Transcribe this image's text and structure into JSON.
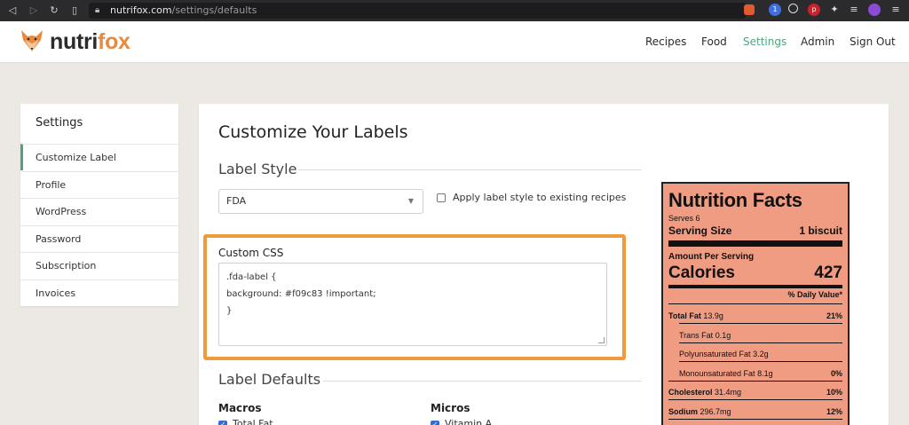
{
  "browser": {
    "url_host": "nutrifox.com",
    "url_path": "/settings/defaults"
  },
  "header": {
    "logo_part1": "nutri",
    "logo_part2": "fox",
    "nav": [
      "Recipes",
      "Food",
      "Settings",
      "Admin",
      "Sign Out"
    ],
    "active_nav": "Settings",
    "accent_color": "#4fa47f"
  },
  "sidebar": {
    "title": "Settings",
    "items": [
      {
        "label": "Customize Label"
      },
      {
        "label": "Profile"
      },
      {
        "label": "WordPress"
      },
      {
        "label": "Password"
      },
      {
        "label": "Subscription"
      },
      {
        "label": "Invoices"
      }
    ],
    "active_item": "Customize Label"
  },
  "main": {
    "title": "Customize Your Labels",
    "label_style_section": "Label Style",
    "style_select_value": "FDA",
    "apply_checkbox_label": "Apply label style to existing recipes",
    "custom_css_label": "Custom CSS",
    "custom_css_lines": [
      ".fda-label {",
      "background: #f09c83 !important;",
      "}"
    ],
    "highlight_color": "#ef9a3b",
    "label_defaults_section": "Label Defaults",
    "macros_heading": "Macros",
    "micros_heading": "Micros",
    "macros_first_item": "Total Fat",
    "micros_first_item": "Vitamin A"
  },
  "nutrition_label": {
    "background": "#f09c83",
    "title": "Nutrition Facts",
    "serves": "Serves 6",
    "serving_size_label": "Serving Size",
    "serving_size_value": "1 biscuit",
    "amount_per_serving": "Amount Per Serving",
    "calories_label": "Calories",
    "calories_value": "427",
    "daily_value_header": "% Daily Value*",
    "rows": [
      {
        "name": "Total Fat",
        "amount": "13.9g",
        "dv": "21%"
      },
      {
        "name": "Trans Fat",
        "amount": "0.1g",
        "dv": ""
      },
      {
        "name": "Polyunsaturated Fat",
        "amount": "3.2g",
        "dv": ""
      },
      {
        "name": "Monounsaturated Fat",
        "amount": "8.1g",
        "dv": "0%"
      },
      {
        "name": "Cholesterol",
        "amount": "31.4mg",
        "dv": "10%"
      },
      {
        "name": "Sodium",
        "amount": "296.7mg",
        "dv": "12%"
      }
    ]
  }
}
